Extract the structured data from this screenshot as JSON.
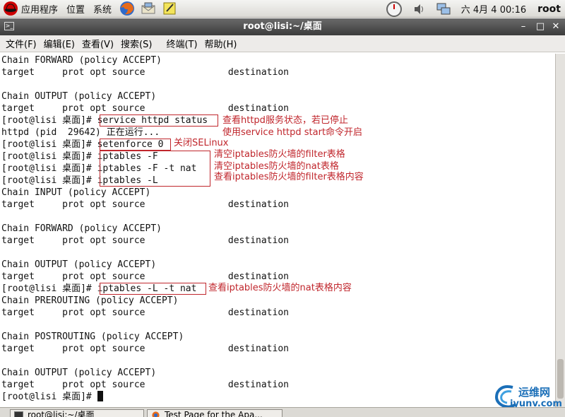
{
  "top_panel": {
    "menus": [
      "应用程序",
      "位置",
      "系统"
    ],
    "clock": "六 4月  4 00:16",
    "user": "root",
    "icons": [
      "redhat-icon",
      "firefox-icon",
      "mail-icon",
      "notes-icon",
      "update-icon",
      "volume-icon",
      "network-icon"
    ]
  },
  "window": {
    "title": "root@lisi:~/桌面",
    "menu": [
      "文件(F)",
      "编辑(E)",
      "查看(V)",
      "搜索(S)",
      "终端(T)",
      "帮助(H)"
    ]
  },
  "terminal": {
    "lines": [
      "Chain FORWARD (policy ACCEPT)",
      "target     prot opt source               destination",
      "",
      "Chain OUTPUT (policy ACCEPT)",
      "target     prot opt source               destination",
      "[root@lisi 桌面]# service httpd status",
      "httpd (pid  29642) 正在运行...",
      "[root@lisi 桌面]# setenforce 0",
      "[root@lisi 桌面]# iptables -F",
      "[root@lisi 桌面]# iptables -F -t nat",
      "[root@lisi 桌面]# iptables -L",
      "Chain INPUT (policy ACCEPT)",
      "target     prot opt source               destination",
      "",
      "Chain FORWARD (policy ACCEPT)",
      "target     prot opt source               destination",
      "",
      "Chain OUTPUT (policy ACCEPT)",
      "target     prot opt source               destination",
      "[root@lisi 桌面]# iptables -L -t nat",
      "Chain PREROUTING (policy ACCEPT)",
      "target     prot opt source               destination",
      "",
      "Chain POSTROUTING (policy ACCEPT)",
      "target     prot opt source               destination",
      "",
      "Chain OUTPUT (policy ACCEPT)",
      "target     prot opt source               destination",
      "[root@lisi 桌面]# "
    ],
    "annotations": [
      "查看httpd服务状态，若已停止",
      "使用service httpd start命令开启",
      "关闭SELinux",
      "清空iptables防火墙的filter表格",
      "清空iptables防火墙的nat表格",
      "查看iptables防火墙的filter表格内容",
      "查看iptables防火墙的nat表格内容"
    ]
  },
  "taskbar": {
    "tasks": [
      "root@lisi:~/桌面",
      "Test Page for the Apa..."
    ]
  },
  "watermark": {
    "text1": "运维网",
    "text2": "iyunv.com"
  }
}
